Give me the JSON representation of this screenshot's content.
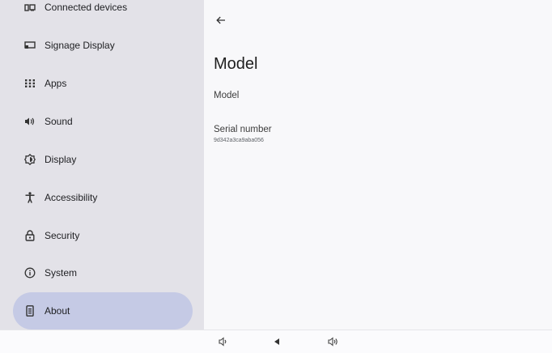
{
  "sidebar": {
    "items": [
      {
        "label": "Connected devices",
        "icon": "connected-devices-icon"
      },
      {
        "label": "Signage Display",
        "icon": "signage-display-icon"
      },
      {
        "label": "Apps",
        "icon": "apps-grid-icon"
      },
      {
        "label": "Sound",
        "icon": "volume-icon"
      },
      {
        "label": "Display",
        "icon": "brightness-icon"
      },
      {
        "label": "Accessibility",
        "icon": "accessibility-icon"
      },
      {
        "label": "Security",
        "icon": "lock-icon"
      },
      {
        "label": "System",
        "icon": "info-icon"
      },
      {
        "label": "About",
        "icon": "device-info-icon",
        "active": true
      }
    ]
  },
  "main": {
    "title": "Model",
    "rows": [
      {
        "title": "Model",
        "subtitle": ""
      },
      {
        "title": "Serial number",
        "subtitle": "9d342a3ca9aba056"
      }
    ]
  },
  "navbar": {
    "buttons": [
      "volume-down-icon",
      "back-triangle-icon",
      "volume-up-icon"
    ]
  },
  "colors": {
    "sidebar_bg": "#e3e2e8",
    "active_item": "#c5cae5",
    "content_bg": "#f8f8fa"
  }
}
